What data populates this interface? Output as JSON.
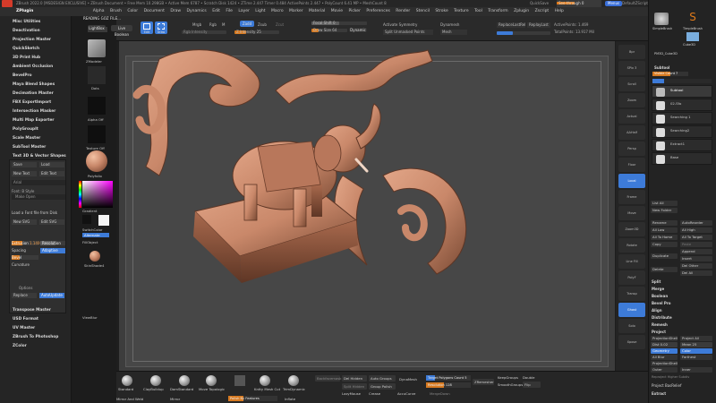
{
  "titlebar": {
    "text": "ZBrush 2022.0 [MSDESIGN EXCLUSIVE] • ZBrush Document • Free Mem 10.298GB • Active Mem 6787 • Scratch Disk 1424 • ZTime 2.447 Timer 0.484 ActivePoints 2.447 • PolyCount 6.41 MP • MeshCount 8",
    "quicksave": "QuickSave",
    "seethrough": "See-through 0",
    "menus_label": "Menus",
    "script_label": "DefaultZScript"
  },
  "menubar": {
    "logo": "ZPlugin",
    "items": [
      "Alpha",
      "Brush",
      "Color",
      "Document",
      "Draw",
      "Dynamics",
      "Edit",
      "File",
      "Layer",
      "Light",
      "Macro",
      "Marker",
      "Material",
      "Movie",
      "Picker",
      "Preferences",
      "Render",
      "Stencil",
      "Stroke",
      "Texture",
      "Tool",
      "Transform",
      "Zplugin",
      "Zscript",
      "Help"
    ]
  },
  "left_tray": {
    "plugins": [
      "Misc Utilities",
      "Deactivation",
      "Projection Master",
      "QuickSketch",
      "3D Print Hub",
      "Ambient Occlusion",
      "BevelPro",
      "Maya Blend Shapes",
      "Decimation Master",
      "FBX ExportImport",
      "Intersection Masker",
      "Multi Map Exporter",
      "PolyGroupIt",
      "Scale Master",
      "SubTool Master",
      "Text 3D & Vector Shapes"
    ],
    "text3d": {
      "save": "Save",
      "load": "Load",
      "new_text": "New Text",
      "edit_text": "Edit Text",
      "font": "Arial",
      "font_label": "Font: B Style",
      "make_open": "Make Open",
      "load_font": "Load a Font file from Disk",
      "new_svg": "New SVG",
      "edit_svg": "Edit SVG",
      "extrusion_label": "Extrusion",
      "extrusion_value": "1.1400",
      "resolution_label": "Resolution",
      "spacing_label": "Spacing",
      "adaptive_label": "Adaptive",
      "bevel_label": "Bevel",
      "curvature_label": "Curvature",
      "options_label": "Options",
      "replace_label": "Replace",
      "autoupdate_label": "AutoUpdate"
    },
    "bottom": [
      "Transpose Master",
      "USD Format",
      "UV Master",
      "ZBrush To Photoshop",
      "ZColor"
    ]
  },
  "col2": {
    "lightbox": "LightBox",
    "zmodeler": "ZModeler",
    "dots": "Dots",
    "alpha": "Alpha Off",
    "texture": "Texture Off",
    "material": "Polyfolio",
    "gradient": "Gradient",
    "switchcolor": "SwitchColor",
    "alternate": "Alternate",
    "fillobject": "FillObject",
    "skinshade": "SkinShade4",
    "viewblur": "ViewBlur"
  },
  "top_shelf": {
    "reading": "READING GOZ FILE...",
    "lightbox": "LightBox",
    "live_boolean": "Live Boolean",
    "edit": "Edit",
    "draw": "Draw",
    "mrgb": "Mrgb",
    "rgb": "Rgb",
    "m": "M",
    "zadd": "Zadd",
    "zsub": "Zsub",
    "zcut": "Zcut",
    "rgb_intensity": "Rgb Intensity",
    "z_intensity": "Z Intensity 25",
    "focal_shift": "Focal Shift 0",
    "draw_size": "Draw Size 64",
    "dynamic": "Dynamic",
    "activate_symmetry": "Activate Symmetry",
    "split_unmasked": "Split Unmasked Points",
    "dynamesh": "Dynamesh",
    "mesh": "Mesh",
    "replace_last": "ReplaceLastRel",
    "replace_last2": "ReplayLast",
    "activepoints": "ActivePoints: 1.469",
    "totalpoints": "TotalPoints: 13.917 Mil"
  },
  "right_bar": {
    "items": [
      "Bpr",
      "SPix 3",
      "Scroll",
      "Zoom",
      "Actual",
      "AAHalf",
      "Persp",
      "Floor",
      "Local",
      "Frame",
      "Move",
      "Zoom3D",
      "Rotate",
      "Line Fill",
      "PolyF",
      "Transp",
      "Ghost",
      "Solo",
      "Xpose"
    ]
  },
  "right_tray": {
    "top_tools": [
      "SimpleBrush",
      "Seethrough",
      "TimpleBrush",
      "Cube3D",
      "PM3D_Cube3D"
    ],
    "subtool_title": "Subtool",
    "visible_count": "Visible Count 7",
    "subtools": [
      "Subtool",
      "02-Sfo",
      "Searching 1",
      "Searching2",
      "Extract1",
      "Base"
    ],
    "buttons": {
      "list_all": "List All",
      "new_folder": "New Folder",
      "rename": "Rename",
      "autoreorder": "AutoReorder",
      "all_low": "All Low",
      "all_high": "All High",
      "all_to_home": "All To Home",
      "all_to_target": "All To Target",
      "copy": "Copy",
      "paste": "Paste",
      "append": "Append",
      "duplicate": "Duplicate",
      "insert": "Insert",
      "delete": "Delete",
      "del_other": "Del Other",
      "del_all": "Del All",
      "split": "Split",
      "merge": "Merge",
      "boolean": "Boolean",
      "bevel_pro": "Bevel Pro",
      "align": "Align",
      "distribute": "Distribute",
      "remesh": "Remesh",
      "project": "Project",
      "projection_shell": "ProjectionShell",
      "project_all": "Project All",
      "dist": "Dist 0.02",
      "mean": "Mean 25",
      "geometry": "Geometry",
      "color": "Color",
      "all_blur": "All Blur",
      "farthest": "Farthest",
      "outer": "Outer",
      "inner": "Inner",
      "reproject": "Reproject Higher Subdiv",
      "project_bas": "Project BasRelief",
      "extract": "Extract"
    }
  },
  "bottom_shelf": {
    "brushes": [
      "Standard",
      "ClayBuildup",
      "DamStandard",
      "Move Topologic",
      "Move",
      "Follow",
      "Kntty Mesh Cut",
      "TrimDynamic"
    ],
    "backface": "Backfacemask",
    "del_hidden": "Del Hidden",
    "auto_groups": "Auto Groups",
    "dynamesh": "DynaMesh",
    "split_hidden": "Split Hidden",
    "group_polish": "Group  Polish",
    "target_polygons": "Target Polygons Count 5",
    "resolution": "Resolution 128",
    "zremesher": "ZRemesher",
    "keepgroups": "KeepGroups",
    "smoothgroups": "SmoothGroups",
    "double": "Double",
    "flip": "Flip",
    "mirror_weld": "Mirror And Weld",
    "mirror": "Mirror",
    "polish_features": "Polish By Features",
    "inflate": "Inflate",
    "lazymouse": "LazyMouse",
    "crease": "Crease",
    "mergedown": "MergeDown",
    "accucurve": "AccuCurve"
  },
  "colors": {
    "clay": "#c9886a",
    "accent_blue": "#3d7bd8",
    "accent_orange": "#e07a1a",
    "canvas_bg": "#474747"
  }
}
